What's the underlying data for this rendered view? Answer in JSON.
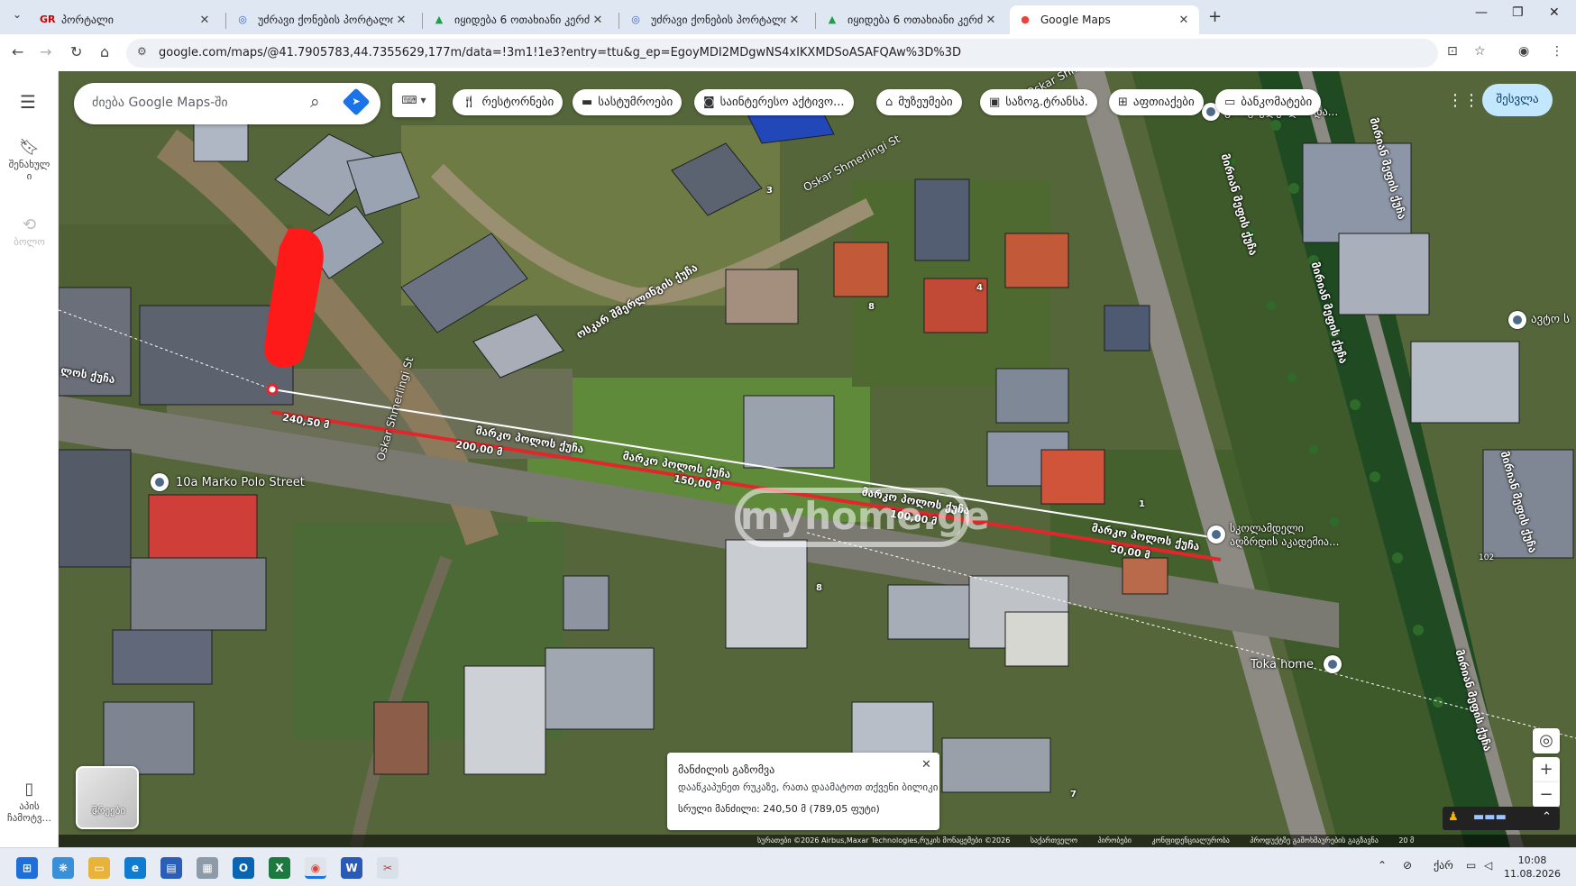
{
  "browser": {
    "tabs": [
      {
        "title": "პორტალი",
        "icon": "gr-icon",
        "active": false
      },
      {
        "title": "უძრავი ქონების პორტალი",
        "icon": "portal-icon",
        "active": false
      },
      {
        "title": "იყიდება 6 ოთახიანი კერძ",
        "icon": "house-icon",
        "active": false
      },
      {
        "title": "უძრავი ქონების პორტალი",
        "icon": "portal-icon",
        "active": false
      },
      {
        "title": "იყიდება 6 ოთახიანი კერძ",
        "icon": "house-icon",
        "active": false
      },
      {
        "title": "Google Maps",
        "icon": "maps-pin-icon",
        "active": true
      }
    ],
    "url": "google.com/maps/@41.7905783,44.7355629,177m/data=!3m1!1e3?entry=ttu&g_ep=EgoyMDI2MDgwNS4xIKXMDSoASAFQAw%3D%3D"
  },
  "sidebar": {
    "saved_label": "შენახულ\nი",
    "recent_label": "ბოლო",
    "app_label": "აპის\nჩამოტვ..."
  },
  "search": {
    "placeholder": "ძიება Google Maps-ში"
  },
  "chips": [
    {
      "label": "რესტორნები",
      "icon": "fork-knife-icon"
    },
    {
      "label": "სასტუმროები",
      "icon": "bed-icon"
    },
    {
      "label": "საინტერესო აქტივო...",
      "icon": "camera-icon"
    },
    {
      "label": "მუზეუმები",
      "icon": "museum-icon"
    },
    {
      "label": "საზოგ.ტრანსპ.",
      "icon": "bus-icon"
    },
    {
      "label": "აფთიაქები",
      "icon": "pharmacy-icon"
    },
    {
      "label": "ბანკომატები",
      "icon": "atm-icon"
    }
  ],
  "signin_label": "შესვლა",
  "map_labels": {
    "street_marko_polo": "მარკო პოლოს ქუჩა",
    "street_marko_polo_short": "ლოს ქუჩა",
    "street_shmerlingi_en": "Oskar Shmerlingi St",
    "street_shmerlingi_ka": "ოსკარ შმერლინგის ქუჩა",
    "street_shmerlingi_en_top": "Oskar Shmer",
    "street_right": "მირიან მეფის ქუჩა",
    "poi_marko_polo": "10a Marko Polo Street",
    "poi_school": "სკოლამდელი\nაღზრდის აკადემია...",
    "poi_toka": "Toka home",
    "poi_school_top": "გამაცხელებლის და...",
    "poi_auto": "ავტო ს",
    "watermark": "myhome.ge",
    "house_num_3": "3",
    "house_num_8": "8",
    "house_num_8b": "8",
    "house_num_4": "4",
    "house_num_1": "1",
    "house_num_7": "7",
    "house_num_102": "102"
  },
  "measure_marks": [
    "240,50 მ",
    "200,00 მ",
    "150,00 მ",
    "100,00 მ",
    "50,00 მ"
  ],
  "measure_card": {
    "title": "მანძილის გაზომვა",
    "hint": "დააწკაპუნეთ რუკაზე, რათა დაამატოთ თქვენი ბილიკი",
    "total": "სრული მანძილი: 240,50 მ (789,05 ფუტი)"
  },
  "layers_label": "შრეები",
  "attribution": [
    "სურათები ©2026 Airbus,Maxar Technologies,რუკის მონაცემები ©2026",
    "საქართველო",
    "პირობები",
    "კონფიდენციალურობა",
    "პროდუქტზე გამოხმაურების გაგზავნა",
    "20 მ"
  ],
  "taskbar": {
    "lang": "ქარ",
    "time": "10:08",
    "date": "11.08.2026"
  },
  "colors": {
    "measure_red": "#e3262b",
    "chip_bg": "#ffffff",
    "signin_bg": "#c2e7ff"
  }
}
